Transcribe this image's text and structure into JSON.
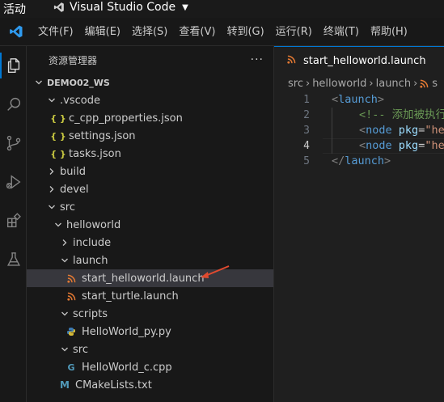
{
  "system_bar": {
    "activities": "活动",
    "app_name": "Visual Studio Code"
  },
  "menu": {
    "items": [
      "文件(F)",
      "编辑(E)",
      "选择(S)",
      "查看(V)",
      "转到(G)",
      "运行(R)",
      "终端(T)",
      "帮助(H)"
    ]
  },
  "sidebar": {
    "title": "资源管理器",
    "more": "···",
    "root": "DEMO02_WS",
    "items": {
      "vscode": ".vscode",
      "c_cpp": "c_cpp_properties.json",
      "settings": "settings.json",
      "tasks": "tasks.json",
      "build": "build",
      "devel": "devel",
      "src": "src",
      "helloworld": "helloworld",
      "include": "include",
      "launch": "launch",
      "start_helloworld": "start_helloworld.launch",
      "start_turtle": "start_turtle.launch",
      "scripts": "scripts",
      "hello_py": "HelloWorld_py.py",
      "src_inner": "src",
      "hello_c": "HelloWorld_c.cpp",
      "cmake": "CMakeLists.txt"
    }
  },
  "editor": {
    "tab_title": "start_helloworld.launch",
    "breadcrumbs": [
      "src",
      "helloworld",
      "launch",
      "s"
    ],
    "lines": [
      {
        "no": "1",
        "open": "<",
        "tag": "launch",
        "close": ">"
      },
      {
        "no": "2",
        "comment": "<!-- 添加被执行"
      },
      {
        "no": "3",
        "open": "<",
        "tag": "node",
        "attr": "pkg",
        "eq": "=",
        "str": "\"he"
      },
      {
        "no": "4",
        "open": "<",
        "tag": "node",
        "attr": "pkg",
        "eq": "=",
        "str": "\"he"
      },
      {
        "no": "5",
        "open": "</",
        "tag": "launch",
        "close": ">"
      }
    ]
  },
  "colors": {
    "accent": "#0078d4",
    "arrow": "#e04a2f"
  }
}
